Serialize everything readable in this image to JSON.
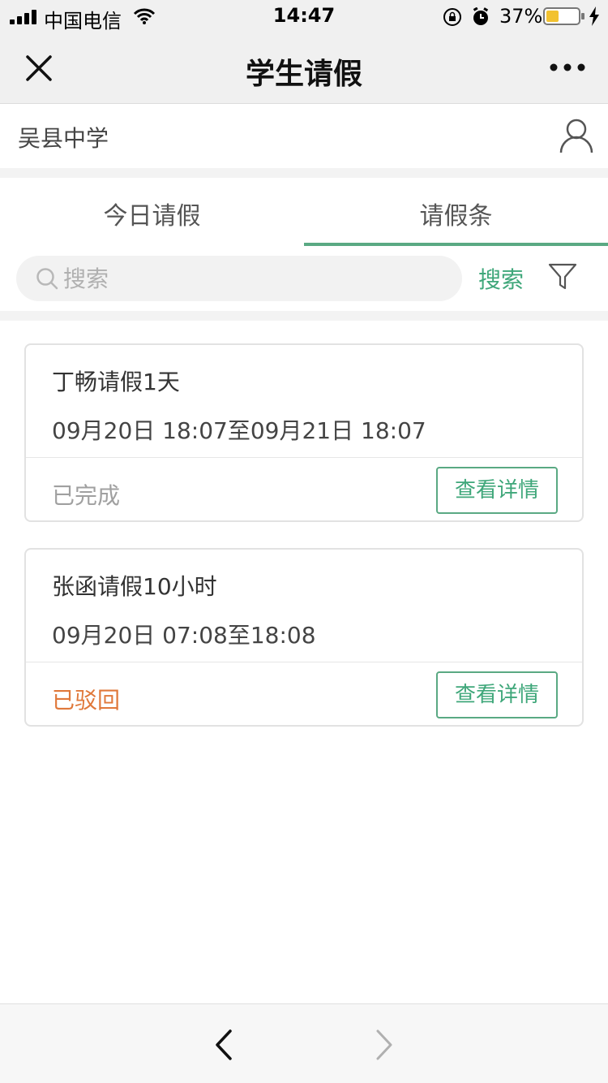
{
  "status_bar": {
    "carrier": "中国电信",
    "time": "14:47",
    "battery_percent": "37%",
    "icons": [
      "signal-icon",
      "wifi-icon",
      "orientation-lock-icon",
      "alarm-icon",
      "battery-icon",
      "charging-icon"
    ]
  },
  "nav": {
    "title": "学生请假",
    "icons": [
      "close-icon",
      "more-icon"
    ]
  },
  "school": {
    "name": "吴县中学",
    "icon": "user-icon"
  },
  "tabs": [
    {
      "label": "今日请假",
      "active": false
    },
    {
      "label": "请假条",
      "active": true
    }
  ],
  "search": {
    "placeholder": "搜索",
    "value": "",
    "button_label": "搜索",
    "icons": [
      "search-icon",
      "filter-icon"
    ]
  },
  "cards": [
    {
      "title": "丁畅请假1天",
      "time": "09月20日 18:07至09月21日 18:07",
      "status": "已完成",
      "status_color": "#a0a0a0",
      "button_label": "查看详情"
    },
    {
      "title": "张函请假10小时",
      "time": "09月20日 07:08至18:08",
      "status": "已驳回",
      "status_color": "#e0783a",
      "button_label": "查看详情"
    }
  ],
  "bottom_bar": {
    "icons": [
      "back-arrow-icon",
      "forward-arrow-icon"
    ]
  },
  "colors": {
    "accent": "#3fa77a",
    "tab_underline": "#5aa983",
    "rejected": "#e0783a",
    "battery_fill": "#f2c230"
  }
}
